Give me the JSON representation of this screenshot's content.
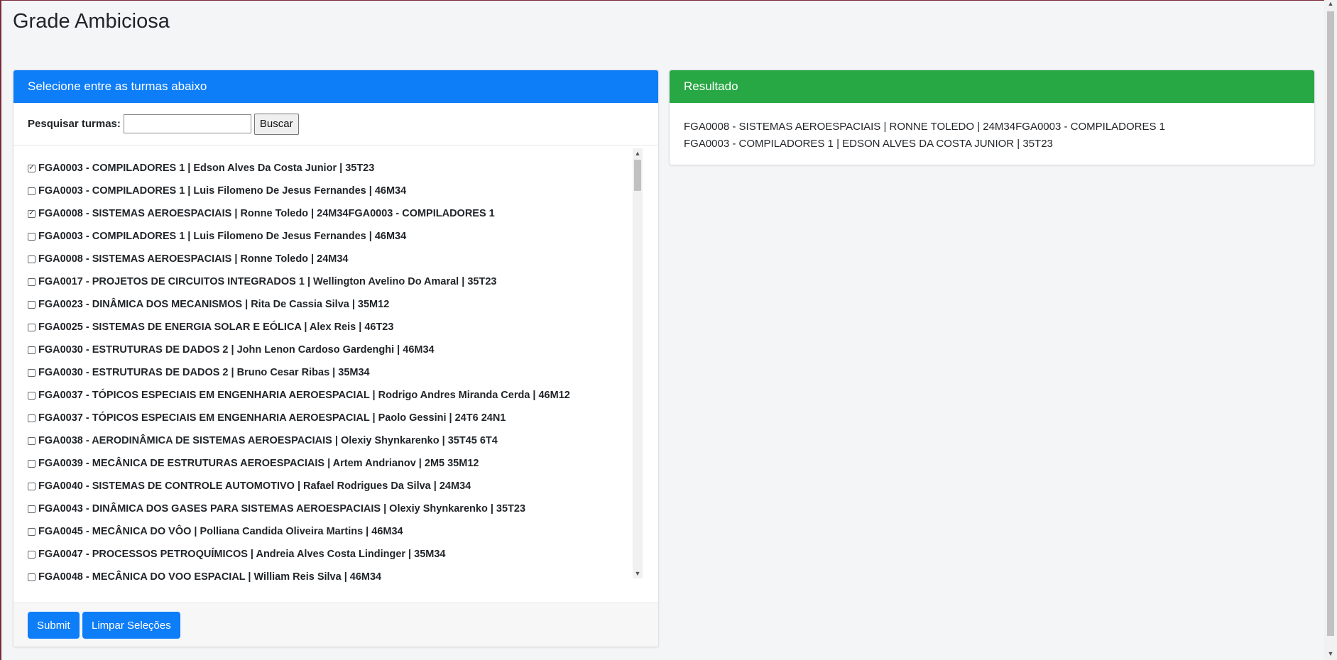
{
  "page": {
    "title": "Grade Ambiciosa"
  },
  "selector": {
    "header": "Selecione entre as turmas abaixo",
    "search_label": "Pesquisar turmas:",
    "search_value": "",
    "search_button": "Buscar",
    "items": [
      {
        "label": "FGA0003 - COMPILADORES 1 | Edson Alves Da Costa Junior | 35T23",
        "checked": true
      },
      {
        "label": "FGA0003 - COMPILADORES 1 | Luis Filomeno De Jesus Fernandes | 46M34",
        "checked": false
      },
      {
        "label": "FGA0008 - SISTEMAS AEROESPACIAIS | Ronne Toledo | 24M34FGA0003 - COMPILADORES 1",
        "checked": true
      },
      {
        "label": "FGA0003 - COMPILADORES 1 | Luis Filomeno De Jesus Fernandes | 46M34",
        "checked": false
      },
      {
        "label": "FGA0008 - SISTEMAS AEROESPACIAIS | Ronne Toledo | 24M34",
        "checked": false
      },
      {
        "label": "FGA0017 - PROJETOS DE CIRCUITOS INTEGRADOS 1 | Wellington Avelino Do Amaral | 35T23",
        "checked": false
      },
      {
        "label": "FGA0023 - DINÂMICA DOS MECANISMOS | Rita De Cassia Silva | 35M12",
        "checked": false
      },
      {
        "label": "FGA0025 - SISTEMAS DE ENERGIA SOLAR E EÓLICA | Alex Reis | 46T23",
        "checked": false
      },
      {
        "label": "FGA0030 - ESTRUTURAS DE DADOS 2 | John Lenon Cardoso Gardenghi | 46M34",
        "checked": false
      },
      {
        "label": "FGA0030 - ESTRUTURAS DE DADOS 2 | Bruno Cesar Ribas | 35M34",
        "checked": false
      },
      {
        "label": "FGA0037 - TÓPICOS ESPECIAIS EM ENGENHARIA AEROESPACIAL | Rodrigo Andres Miranda Cerda | 46M12",
        "checked": false
      },
      {
        "label": "FGA0037 - TÓPICOS ESPECIAIS EM ENGENHARIA AEROESPACIAL | Paolo Gessini | 24T6 24N1",
        "checked": false
      },
      {
        "label": "FGA0038 - AERODINÂMICA DE SISTEMAS AEROESPACIAIS | Olexiy Shynkarenko | 35T45 6T4",
        "checked": false
      },
      {
        "label": "FGA0039 - MECÂNICA DE ESTRUTURAS AEROESPACIAIS | Artem Andrianov | 2M5 35M12",
        "checked": false
      },
      {
        "label": "FGA0040 - SISTEMAS DE CONTROLE AUTOMOTIVO | Rafael Rodrigues Da Silva | 24M34",
        "checked": false
      },
      {
        "label": "FGA0043 - DINÂMICA DOS GASES PARA SISTEMAS AEROESPACIAIS | Olexiy Shynkarenko | 35T23",
        "checked": false
      },
      {
        "label": "FGA0045 - MECÂNICA DO VÔO | Polliana Candida Oliveira Martins | 46M34",
        "checked": false
      },
      {
        "label": "FGA0047 - PROCESSOS PETROQUÍMICOS | Andreia Alves Costa Lindinger | 35M34",
        "checked": false
      },
      {
        "label": "FGA0048 - MECÂNICA DO VOO ESPACIAL | William Reis Silva | 46M34",
        "checked": false
      }
    ],
    "submit_button": "Submit",
    "clear_button": "Limpar Seleções"
  },
  "result": {
    "header": "Resultado",
    "lines": [
      "FGA0008 - SISTEMAS AEROESPACIAIS | RONNE TOLEDO | 24M34FGA0003 - COMPILADORES 1",
      "FGA0003 - COMPILADORES 1 | EDSON ALVES DA COSTA JUNIOR | 35T23"
    ]
  }
}
